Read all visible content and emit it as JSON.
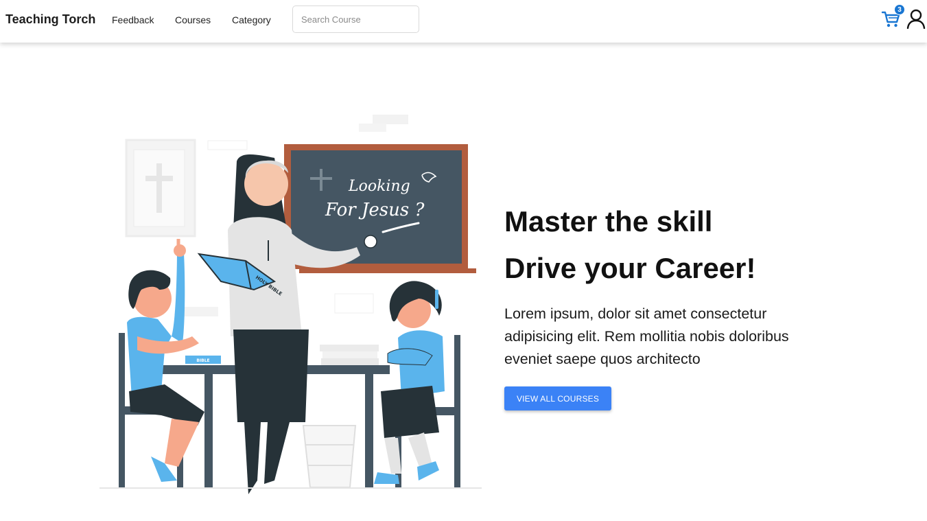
{
  "nav": {
    "brand": "Teaching Torch",
    "links": [
      "Feedback",
      "Courses",
      "Category"
    ],
    "search_placeholder": "Search Course",
    "cart_count": "3"
  },
  "icons": {
    "cart": "cart-icon",
    "user": "user-icon"
  },
  "hero": {
    "headline_line1": "Master the skill",
    "headline_line2": "Drive your Career!",
    "description": "Lorem ipsum, dolor sit amet consectetur adipisicing elit. Rem mollitia nobis doloribus eveniet saepe quos architecto",
    "button_label": "VIEW ALL COURSES",
    "illustration": {
      "board_text_line1": "Looking",
      "board_text_line2": "For Jesus ?",
      "book_label": "HOLY BIBLE",
      "desk_book_label": "BIBLE"
    }
  },
  "colors": {
    "accent": "#3b82f6",
    "badge": "#1976d2",
    "chalkboard": "#455663",
    "board_frame": "#b25d3e",
    "uniform_blue": "#5ab4ec",
    "dark": "#263238"
  }
}
